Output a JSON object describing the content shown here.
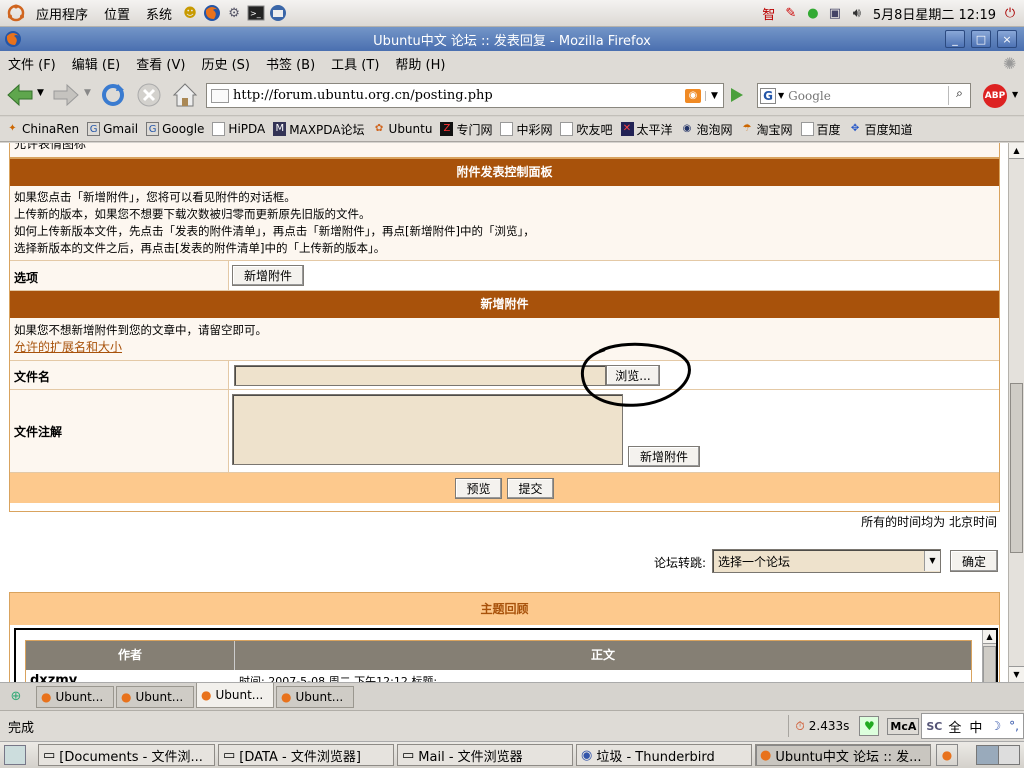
{
  "top_panel": {
    "menus": [
      "应用程序",
      "位置",
      "系统"
    ],
    "clock": "5月8日星期二 12:19",
    "tray_text": "智"
  },
  "window": {
    "title": "Ubuntu中文 论坛 :: 发表回复 - Mozilla Firefox",
    "min_label": "_",
    "max_label": "□",
    "close_label": "×"
  },
  "menubar": [
    "文件 (F)",
    "编辑 (E)",
    "查看 (V)",
    "历史 (S)",
    "书签 (B)",
    "工具 (T)",
    "帮助 (H)"
  ],
  "navbar": {
    "url": "http://forum.ubuntu.org.cn/posting.php",
    "search_placeholder": "Google",
    "search_engine": "G"
  },
  "bookmarks": [
    {
      "label": "ChinaRen",
      "icon": "star-icon"
    },
    {
      "label": "Gmail",
      "icon": "g-icon"
    },
    {
      "label": "Google",
      "icon": "g-icon"
    },
    {
      "label": "HiPDA",
      "icon": "page-icon"
    },
    {
      "label": "MAXPDA论坛",
      "icon": "maxpda-icon"
    },
    {
      "label": "Ubuntu",
      "icon": "ubuntu-icon"
    },
    {
      "label": "专门网",
      "icon": "zm-icon"
    },
    {
      "label": "中彩网",
      "icon": "page-icon"
    },
    {
      "label": "吹友吧",
      "icon": "page-icon"
    },
    {
      "label": "太平洋",
      "icon": "pconline-icon"
    },
    {
      "label": "泡泡网",
      "icon": "pcpop-icon"
    },
    {
      "label": "淘宝网",
      "icon": "taobao-icon"
    },
    {
      "label": "百度",
      "icon": "page-icon"
    },
    {
      "label": "百度知道",
      "icon": "paw-icon"
    }
  ],
  "page": {
    "partial_top": "允许表情图标",
    "attach_panel_title": "附件发表控制面板",
    "attach_help": [
      "如果您点击「新增附件」，您将可以看见附件的对话框。",
      "上传新的版本，如果您不想要下载次数被归零而更新原先旧版的文件。",
      "如何上传新版本文件，先点击「发表的附件清单」，再点击「新增附件」，再点[新增附件]中的「浏览」，",
      "选择新版本的文件之后，再点击[发表的附件清单]中的「上传新的版本」。"
    ],
    "options_label": "选项",
    "add_attach_button": "新增附件",
    "new_attach_title": "新增附件",
    "new_attach_hint": "如果您不想新增附件到您的文章中，请留空即可。",
    "ext_link": "允许的扩展名和大小",
    "filename_label": "文件名",
    "browse_button": "浏览...",
    "file_comment_label": "文件注解",
    "add_attach_button2": "新增附件",
    "preview_button": "预览",
    "submit_button": "提交",
    "timezone_note": "所有的时间均为 北京时间",
    "jump_label": "论坛转跳:",
    "jump_select": "选择一个论坛",
    "jump_go": "确定",
    "topic_review_title": "主题回顾",
    "review_col_author": "作者",
    "review_col_body": "正文",
    "review_author": "dxzmy",
    "review_meta": "时间: 2007-5-08 周二 下午12:12    标题:"
  },
  "tabs": [
    "Ubunt...",
    "Ubunt...",
    "Ubunt...",
    "Ubunt..."
  ],
  "active_tab_index": 2,
  "status": {
    "text": "完成",
    "timer": "2.433s",
    "mca": "McA",
    "ime": [
      "全",
      "中",
      "☽",
      "°,"
    ]
  },
  "taskbar": [
    "[Documents - 文件浏...",
    "[DATA - 文件浏览器]",
    "Mail - 文件浏览器",
    "垃圾 - Thunderbird",
    "Ubuntu中文 论坛 :: 发..."
  ],
  "colors": {
    "header_brown": "#a8520b",
    "panel_bg": "#fdf7f0",
    "field_bg": "#eee2cc",
    "title_blue": "#4a6fb0"
  }
}
